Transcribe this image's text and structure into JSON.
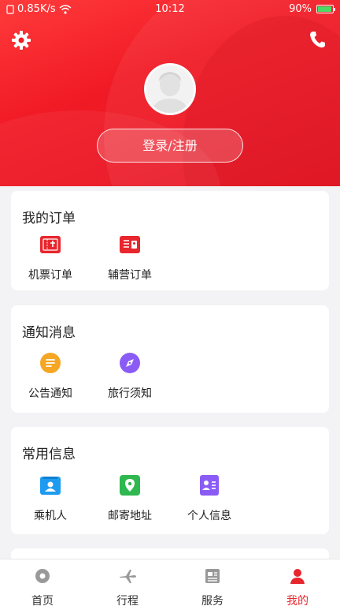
{
  "status_bar": {
    "speed": "0.85K/s",
    "time": "10:12",
    "battery": "90%"
  },
  "header": {
    "login_label": "登录/注册"
  },
  "orders": {
    "title": "我的订单",
    "items": [
      {
        "label": "机票订单",
        "icon": "ticket-icon",
        "color": "#e8262d"
      },
      {
        "label": "辅营订单",
        "icon": "ancillary-icon",
        "color": "#e8262d"
      }
    ]
  },
  "notices": {
    "title": "通知消息",
    "items": [
      {
        "label": "公告通知",
        "icon": "announcement-icon",
        "color": "#f5a623"
      },
      {
        "label": "旅行须知",
        "icon": "compass-icon",
        "color": "#8a5cf5"
      }
    ]
  },
  "common_info": {
    "title": "常用信息",
    "items": [
      {
        "label": "乘机人",
        "icon": "passenger-icon",
        "color": "#1e9bf0"
      },
      {
        "label": "邮寄地址",
        "icon": "location-icon",
        "color": "#2fb84f"
      },
      {
        "label": "个人信息",
        "icon": "profile-icon",
        "color": "#8a5cf5"
      }
    ]
  },
  "tabbar": {
    "items": [
      {
        "label": "首页",
        "icon": "home-icon"
      },
      {
        "label": "行程",
        "icon": "plane-icon"
      },
      {
        "label": "服务",
        "icon": "service-icon"
      },
      {
        "label": "我的",
        "icon": "user-icon"
      }
    ],
    "active_index": 3,
    "active_color": "#e8262d"
  }
}
